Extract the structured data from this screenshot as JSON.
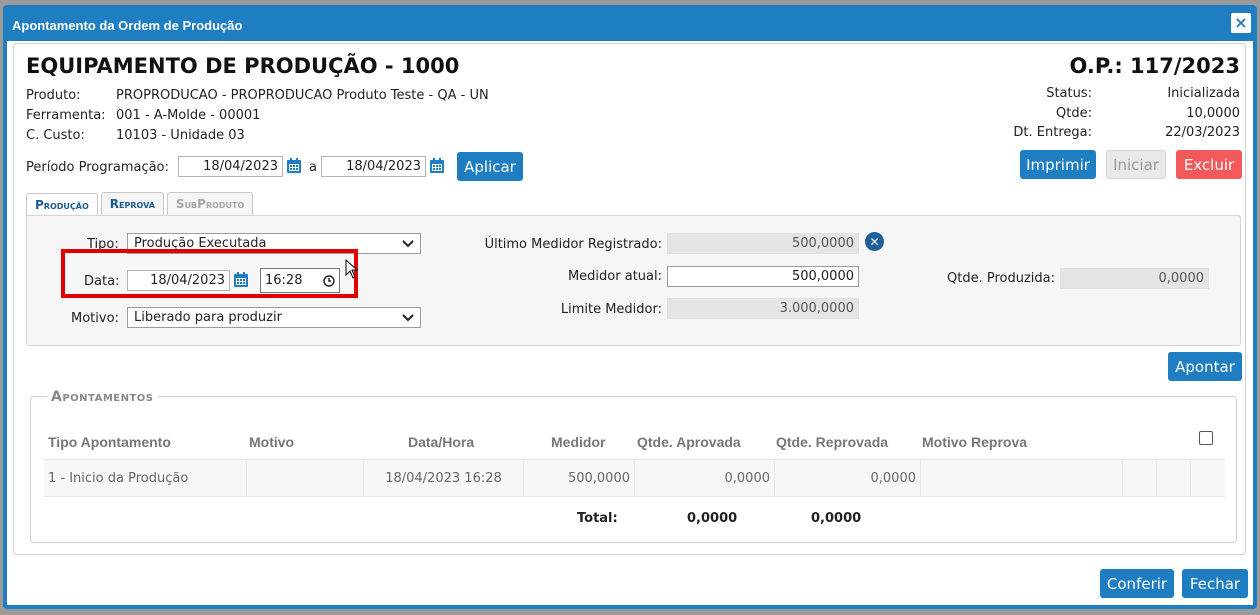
{
  "dialog": {
    "title": "Apontamento da Ordem de Produção",
    "close_glyph": "×"
  },
  "header": {
    "title": "EQUIPAMENTO DE PRODUÇÃO - 1000",
    "op": "O.P.: 117/2023",
    "produto_label": "Produto:",
    "produto_value": "PROPRODUCAO - PROPRODUCAO Produto Teste - QA - UN",
    "ferramenta_label": "Ferramenta:",
    "ferramenta_value": "001 - A-Molde - 00001",
    "custo_label": "C. Custo:",
    "custo_value": "10103 - Unidade 03",
    "status_label": "Status:",
    "status_value": "Inicializada",
    "qtde_label": "Qtde:",
    "qtde_value": "10,0000",
    "entrega_label": "Dt. Entrega:",
    "entrega_value": "22/03/2023"
  },
  "period": {
    "label": "Período Programação:",
    "start": "18/04/2023",
    "sep": "a",
    "end": "18/04/2023",
    "apply_label": "Aplicar"
  },
  "actions": {
    "print_label": "Imprimir",
    "start_label": "Iniciar",
    "delete_label": "Excluir",
    "apontar_label": "Apontar",
    "conferir_label": "Conferir",
    "fechar_label": "Fechar"
  },
  "tabs": [
    {
      "label": "Produção"
    },
    {
      "label": "Reprova"
    },
    {
      "label": "SubProduto"
    }
  ],
  "form": {
    "tipo_label": "Tipo:",
    "tipo_value": "Produção Executada",
    "data_label": "Data:",
    "data_value": "18/04/2023",
    "hora_value": "16:28",
    "motivo_label": "Motivo:",
    "motivo_value": "Liberado para produzir",
    "ultimo_label": "Último Medidor Registrado:",
    "ultimo_value": "500,0000",
    "atual_label": "Medidor atual:",
    "atual_value": "500,0000",
    "limite_label": "Limite Medidor:",
    "limite_value": "3.000,0000",
    "produzida_label": "Qtde. Produzida:",
    "produzida_value": "0,0000"
  },
  "apontamentos": {
    "legend": "Apontamentos",
    "columns": [
      "Tipo Apontamento",
      "Motivo",
      "Data/Hora",
      "Medidor",
      "Qtde. Aprovada",
      "Qtde. Reprovada",
      "Motivo Reprova"
    ],
    "rows": [
      {
        "tipo": "1 - Inicio da Produção",
        "motivo": "",
        "datahora": "18/04/2023 16:28",
        "medidor": "500,0000",
        "aprovada": "0,0000",
        "reprovada": "0,0000",
        "motivo_reprova": ""
      }
    ],
    "total_label": "Total:",
    "total_aprovada": "0,0000",
    "total_reprovada": "0,0000"
  },
  "colors": {
    "primary": "#1f7ec1",
    "danger": "#f1595b",
    "highlight": "#e00000"
  }
}
